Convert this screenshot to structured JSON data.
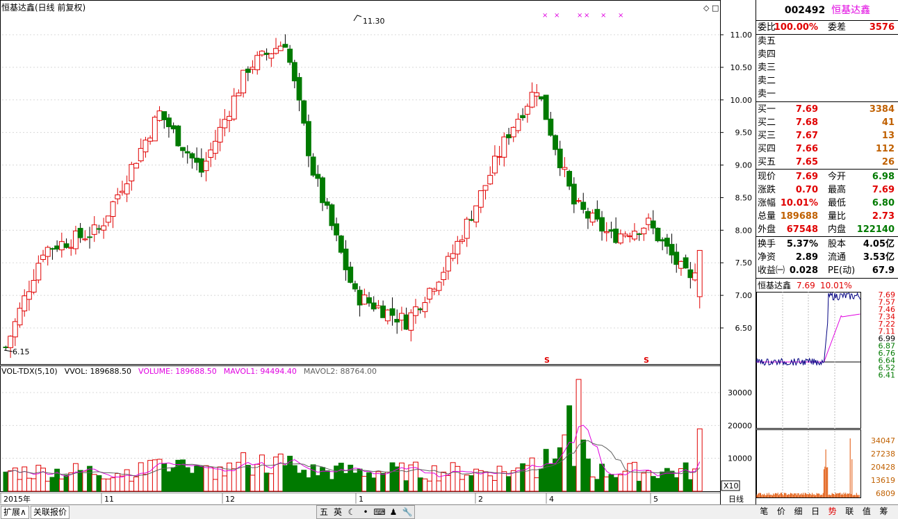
{
  "title": "恒基达鑫(日线 前复权)",
  "price_axis": [
    "11.00",
    "10.50",
    "10.00",
    "9.50",
    "9.00",
    "8.50",
    "8.00",
    "7.50",
    "7.00",
    "6.50"
  ],
  "high_label": "11.30",
  "low_label": "6.15",
  "vol_header": {
    "indicator": "VOL-TDX(5,10)",
    "vvol": "VVOL: 189688.50",
    "volume": "VOLUME: 189688.50",
    "mavol1": "MAVOL1: 94494.40",
    "mavol2": "MAVOL2: 88764.00"
  },
  "vol_axis": [
    "30000",
    "20000",
    "10000"
  ],
  "vol_unit": "X10",
  "time_axis": [
    "2015年",
    "11",
    "12",
    "1",
    "2",
    "4",
    "5"
  ],
  "period": "日线",
  "markers": {
    "top": "×",
    "signal": "S"
  },
  "quote": {
    "code": "002492",
    "name": "恒基达鑫",
    "weibi_label": "委比",
    "weibi": "100.00%",
    "weicha_label": "委差",
    "weicha": "3576",
    "sell": [
      {
        "label": "卖五",
        "price": "",
        "vol": ""
      },
      {
        "label": "卖四",
        "price": "",
        "vol": ""
      },
      {
        "label": "卖三",
        "price": "",
        "vol": ""
      },
      {
        "label": "卖二",
        "price": "",
        "vol": ""
      },
      {
        "label": "卖一",
        "price": "",
        "vol": ""
      }
    ],
    "buy": [
      {
        "label": "买一",
        "price": "7.69",
        "vol": "3384"
      },
      {
        "label": "买二",
        "price": "7.68",
        "vol": "41"
      },
      {
        "label": "买三",
        "price": "7.67",
        "vol": "13"
      },
      {
        "label": "买四",
        "price": "7.66",
        "vol": "112"
      },
      {
        "label": "买五",
        "price": "7.65",
        "vol": "26"
      }
    ],
    "stats": [
      {
        "l1": "现价",
        "v1": "7.69",
        "c1": "red",
        "l2": "今开",
        "v2": "6.98",
        "c2": "green"
      },
      {
        "l1": "涨跌",
        "v1": "0.70",
        "c1": "red",
        "l2": "最高",
        "v2": "7.69",
        "c2": "red"
      },
      {
        "l1": "涨幅",
        "v1": "10.01%",
        "c1": "red",
        "l2": "最低",
        "v2": "6.80",
        "c2": "green"
      },
      {
        "l1": "总量",
        "v1": "189688",
        "c1": "orange",
        "l2": "量比",
        "v2": "2.73",
        "c2": "red"
      },
      {
        "l1": "外盘",
        "v1": "67548",
        "c1": "red",
        "l2": "内盘",
        "v2": "122140",
        "c2": "green"
      }
    ],
    "stats2": [
      {
        "l1": "换手",
        "v1": "5.37%",
        "l2": "股本",
        "v2": "4.05亿"
      },
      {
        "l1": "净资",
        "v1": "2.89",
        "l2": "流通",
        "v2": "3.53亿"
      },
      {
        "l1": "收益㈠",
        "v1": "0.028",
        "l2": "PE(动)",
        "v2": "67.9"
      }
    ]
  },
  "mini": {
    "name": "恒基达鑫",
    "price": "7.69",
    "pct": "10.01%",
    "price_axis": [
      "7.69",
      "7.57",
      "7.46",
      "7.34",
      "7.22",
      "7.11",
      "6.99",
      "6.87",
      "6.76",
      "6.64",
      "6.52",
      "6.41"
    ],
    "vol_axis": [
      "34047",
      "27238",
      "20428",
      "13619",
      "6809"
    ]
  },
  "bottom_tabs": [
    "扩展∧",
    "关联报价"
  ],
  "toolbar": [
    "五",
    "英",
    "☾",
    "•",
    "⌨",
    "♟",
    "🔧"
  ],
  "right_tabs": [
    "笔",
    "价",
    "细",
    "日",
    "势",
    "联",
    "值",
    "筹"
  ],
  "colors": {
    "up": "#e00000",
    "down": "#007a00",
    "ma1": "#e000e0",
    "ma2": "#606060",
    "line": "#000080"
  }
}
